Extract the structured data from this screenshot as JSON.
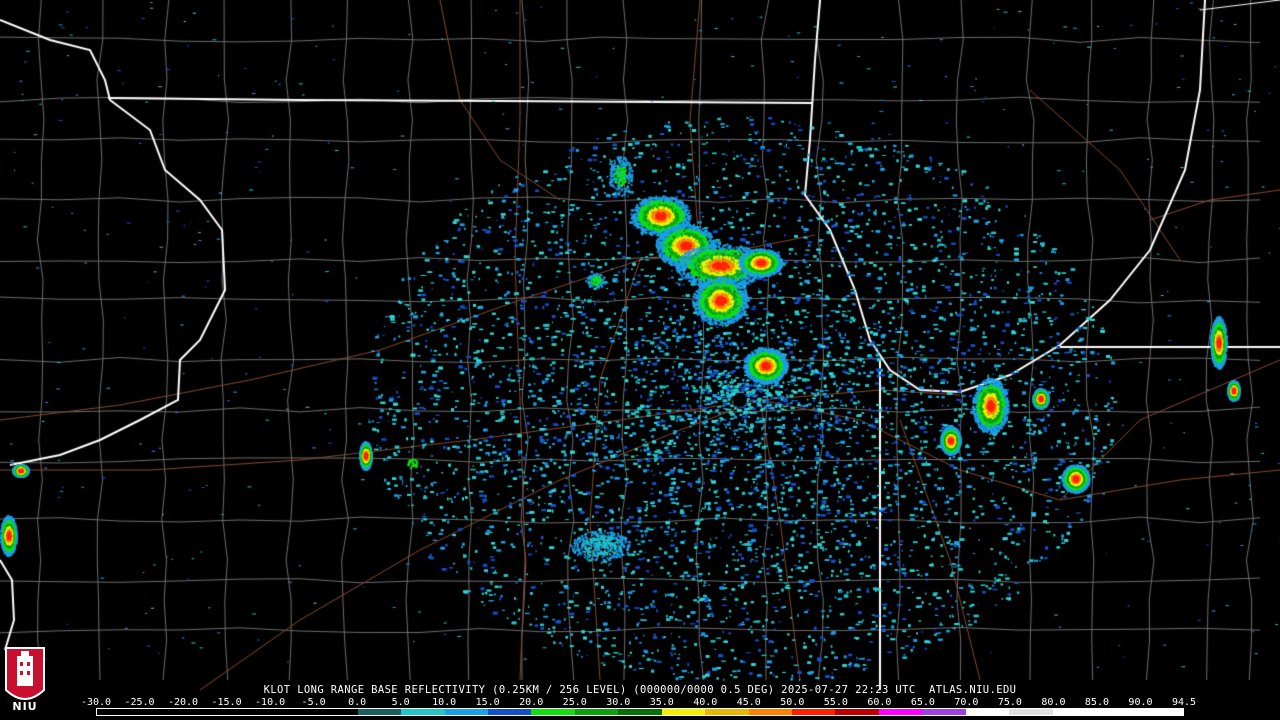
{
  "caption": {
    "product_line": "KLOT LONG RANGE BASE REFLECTIVITY (0.25KM / 256 LEVEL) (000000/0000 0.5 DEG) 2025-07-27 22:23 UTC  ATLAS.NIU.EDU"
  },
  "color_scale": {
    "labels": [
      "-30.0",
      "-25.0",
      "-20.0",
      "-15.0",
      "-10.0",
      "-5.0",
      "0.0",
      "5.0",
      "10.0",
      "15.0",
      "20.0",
      "25.0",
      "30.0",
      "35.0",
      "40.0",
      "45.0",
      "50.0",
      "55.0",
      "60.0",
      "65.0",
      "70.0",
      "75.0",
      "80.0",
      "85.0",
      "90.0",
      "94.5"
    ],
    "colors": [
      "#000000",
      "#000000",
      "#000000",
      "#000000",
      "#000000",
      "#000000",
      "#1a6060",
      "#22c4c4",
      "#1aa0e8",
      "#1450d0",
      "#10e010",
      "#0ca00c",
      "#087008",
      "#f0f000",
      "#e8b800",
      "#ff8000",
      "#ff2000",
      "#c00000",
      "#ff00ff",
      "#a040e0",
      "#ffffff",
      "#e0e0e0",
      "#ffffff",
      "#ffffff",
      "#ffffff"
    ]
  },
  "logo": {
    "text": "NIU"
  },
  "colors": {
    "state_border": "#ffffff",
    "county_border": "#6e6e6e",
    "road": "#8a4a2a"
  }
}
